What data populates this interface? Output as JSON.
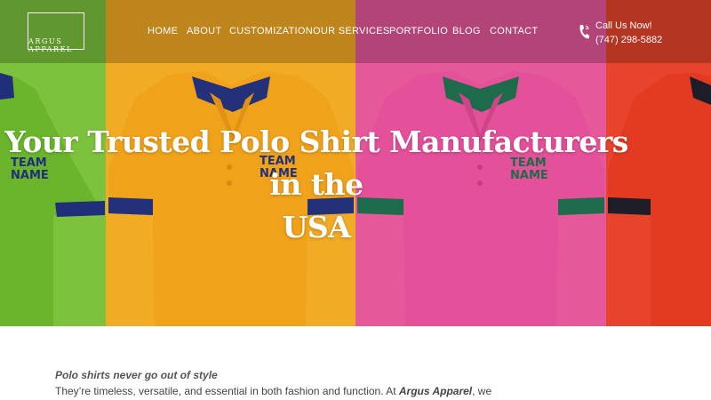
{
  "brand": {
    "name": "ARGUS APPAREL",
    "line1": "ARGUS",
    "line2": "APPAREL"
  },
  "nav": {
    "items": [
      {
        "label": "HOME"
      },
      {
        "label": "ABOUT"
      },
      {
        "label": "CUSTOMIZATION"
      },
      {
        "label": "OUR SERVICES"
      },
      {
        "label": "PORTFOLIO"
      },
      {
        "label": "BLOG"
      },
      {
        "label": "CONTACT"
      }
    ]
  },
  "phone": {
    "cta": "Call Us Now!",
    "number": "(747) 298-5882",
    "icon": "phone-icon"
  },
  "hero": {
    "headline_line1": "Your Trusted Polo Shirt Manufacturers in the",
    "headline_line2": "USA",
    "shirt_print_line1": "TEAM",
    "shirt_print_line2": "NAME",
    "colors": {
      "green": "#7cc23c",
      "yellow": "#f2ab25",
      "pink": "#e5589a",
      "red": "#e8442d"
    }
  },
  "intro": {
    "heading": "Polo shirts never go out of style",
    "text_before": "They’re timeless, versatile, and essential in both fashion and function. At ",
    "brand_em": "Argus Apparel",
    "text_after": ", we"
  }
}
